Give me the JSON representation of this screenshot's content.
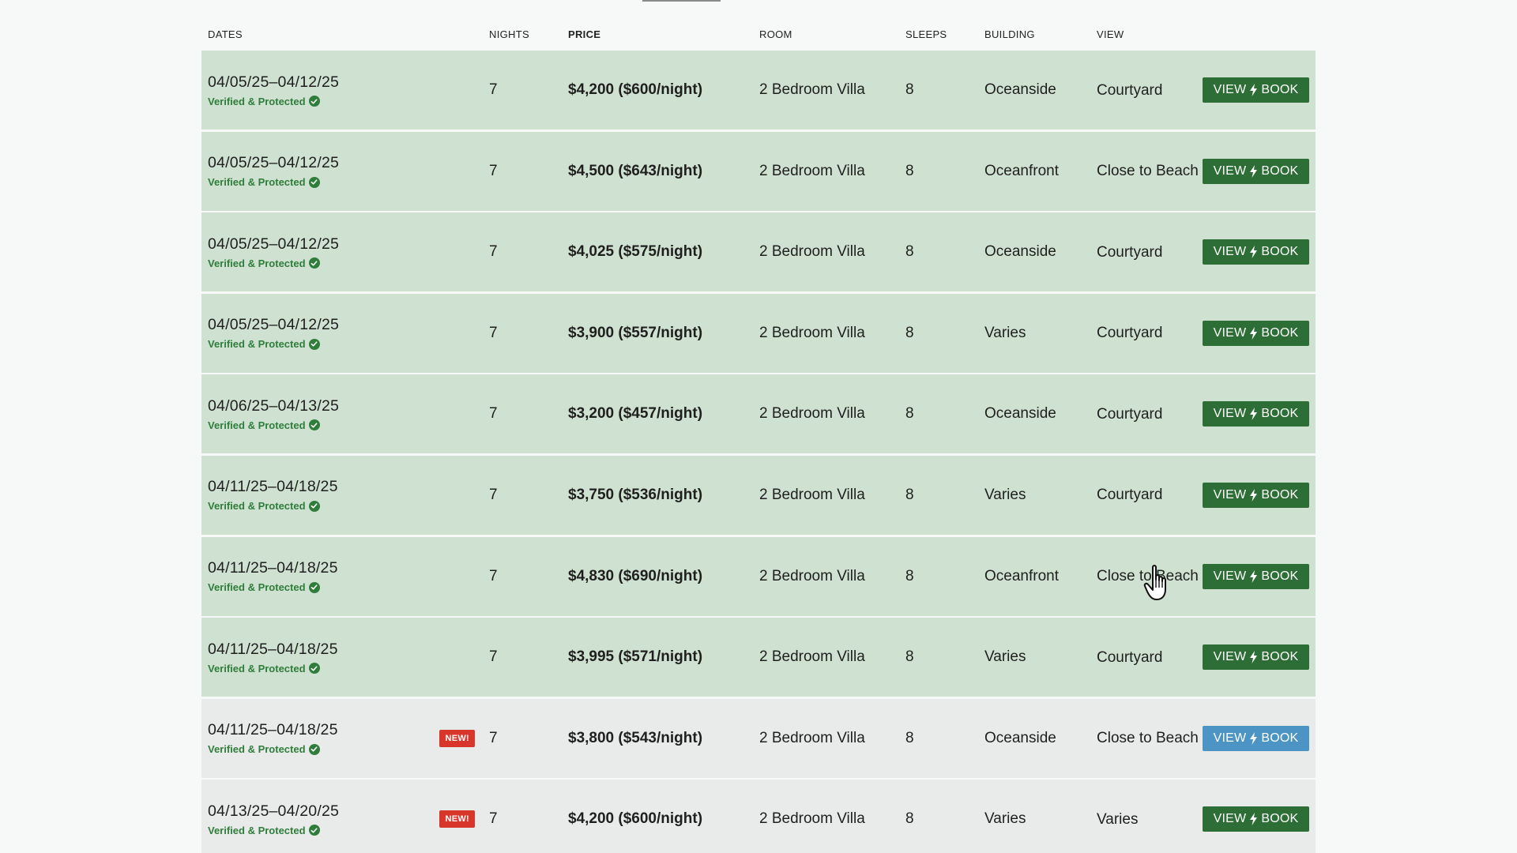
{
  "header": {
    "dates": "DATES",
    "nights": "NIGHTS",
    "price": "PRICE",
    "room": "ROOM",
    "sleeps": "SLEEPS",
    "building": "BUILDING",
    "view": "VIEW"
  },
  "colors": {
    "row_green": "#cfe1d1",
    "row_gray": "#e9ebea",
    "button_green": "#2c6e35",
    "button_blue": "#4b94c4",
    "verified_green": "#2f7d3b",
    "new_badge_red": "#d9362b"
  },
  "icons": [
    "check-circle-icon",
    "lightning-bolt-icon",
    "hand-pointer-cursor-icon"
  ],
  "rows": [
    {
      "dates": "04/05/25–04/12/25",
      "verified": "Verified & Protected",
      "new": "",
      "nights": "7",
      "price": "$4,200 ($600/night)",
      "room": "2 Bedroom Villa",
      "sleeps": "8",
      "building": "Oceanside",
      "view": "Courtyard",
      "btn_left": "VIEW",
      "btn_right": "BOOK"
    },
    {
      "dates": "04/05/25–04/12/25",
      "verified": "Verified & Protected",
      "new": "",
      "nights": "7",
      "price": "$4,500 ($643/night)",
      "room": "2 Bedroom Villa",
      "sleeps": "8",
      "building": "Oceanfront",
      "view": "Close to Beach",
      "btn_left": "VIEW",
      "btn_right": "BOOK"
    },
    {
      "dates": "04/05/25–04/12/25",
      "verified": "Verified & Protected",
      "new": "",
      "nights": "7",
      "price": "$4,025 ($575/night)",
      "room": "2 Bedroom Villa",
      "sleeps": "8",
      "building": "Oceanside",
      "view": "Courtyard",
      "btn_left": "VIEW",
      "btn_right": "BOOK"
    },
    {
      "dates": "04/05/25–04/12/25",
      "verified": "Verified & Protected",
      "new": "",
      "nights": "7",
      "price": "$3,900 ($557/night)",
      "room": "2 Bedroom Villa",
      "sleeps": "8",
      "building": "Varies",
      "view": "Courtyard",
      "btn_left": "VIEW",
      "btn_right": "BOOK"
    },
    {
      "dates": "04/06/25–04/13/25",
      "verified": "Verified & Protected",
      "new": "",
      "nights": "7",
      "price": "$3,200 ($457/night)",
      "room": "2 Bedroom Villa",
      "sleeps": "8",
      "building": "Oceanside",
      "view": "Courtyard",
      "btn_left": "VIEW",
      "btn_right": "BOOK"
    },
    {
      "dates": "04/11/25–04/18/25",
      "verified": "Verified & Protected",
      "new": "",
      "nights": "7",
      "price": "$3,750 ($536/night)",
      "room": "2 Bedroom Villa",
      "sleeps": "8",
      "building": "Varies",
      "view": "Courtyard",
      "btn_left": "VIEW",
      "btn_right": "BOOK"
    },
    {
      "dates": "04/11/25–04/18/25",
      "verified": "Verified & Protected",
      "new": "",
      "nights": "7",
      "price": "$4,830 ($690/night)",
      "room": "2 Bedroom Villa",
      "sleeps": "8",
      "building": "Oceanfront",
      "view": "Close to Beach",
      "btn_left": "VIEW",
      "btn_right": "BOOK"
    },
    {
      "dates": "04/11/25–04/18/25",
      "verified": "Verified & Protected",
      "new": "",
      "nights": "7",
      "price": "$3,995 ($571/night)",
      "room": "2 Bedroom Villa",
      "sleeps": "8",
      "building": "Varies",
      "view": "Courtyard",
      "btn_left": "VIEW",
      "btn_right": "BOOK"
    },
    {
      "dates": "04/11/25–04/18/25",
      "verified": "Verified & Protected",
      "new": "NEW!",
      "nights": "7",
      "price": "$3,800 ($543/night)",
      "room": "2 Bedroom Villa",
      "sleeps": "8",
      "building": "Oceanside",
      "view": "Close to Beach",
      "btn_left": "VIEW",
      "btn_right": "BOOK"
    },
    {
      "dates": "04/13/25–04/20/25",
      "verified": "Verified & Protected",
      "new": "NEW!",
      "nights": "7",
      "price": "$4,200 ($600/night)",
      "room": "2 Bedroom Villa",
      "sleeps": "8",
      "building": "Varies",
      "view": "Varies",
      "btn_left": "VIEW",
      "btn_right": "BOOK"
    }
  ]
}
